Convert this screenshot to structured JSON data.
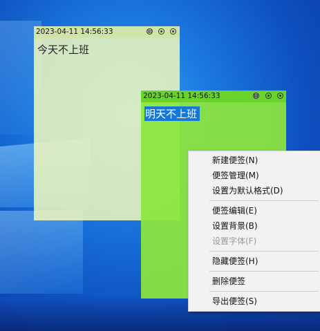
{
  "notes": [
    {
      "timestamp": "2023-04-11 14:56:33",
      "content": "今天不上班",
      "icons": [
        "grid-icon",
        "settings-dot-icon",
        "close-dot-icon"
      ]
    },
    {
      "timestamp": "2023-04-11 14:56:33",
      "content": "明天不上班",
      "icons": [
        "grid-icon",
        "settings-dot-icon",
        "close-dot-icon"
      ]
    }
  ],
  "context_menu": {
    "items": [
      {
        "label": "新建便签(N)",
        "enabled": true
      },
      {
        "label": "便签管理(M)",
        "enabled": true
      },
      {
        "label": "设置为默认格式(D)",
        "enabled": true
      },
      {
        "label": "便签编辑(E)",
        "enabled": true
      },
      {
        "label": "设置背景(B)",
        "enabled": true
      },
      {
        "label": "设置字体(F)",
        "enabled": false
      },
      {
        "label": "隐藏便签(H)",
        "enabled": true
      },
      {
        "label": "删除便签",
        "enabled": true
      },
      {
        "label": "导出便签(S)",
        "enabled": true
      }
    ]
  },
  "colors": {
    "note_1_background": "#ebf5be",
    "note_2_background": "#8ce63c",
    "selection": "#1577d8",
    "menu_background": "#f2f2f2",
    "desktop": "#1560c8"
  }
}
